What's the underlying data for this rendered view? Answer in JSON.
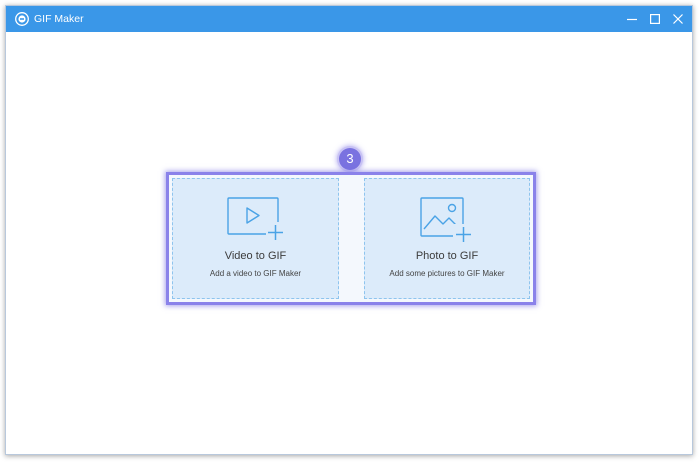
{
  "window": {
    "title": "GIF Maker",
    "app_icon": "gif-maker-logo-icon",
    "controls": {
      "minimize_icon": "minimize-icon",
      "maximize_icon": "maximize-icon",
      "close_icon": "close-icon"
    }
  },
  "step": {
    "number": "3",
    "color": "#7a72e0"
  },
  "options": [
    {
      "title": "Video to GIF",
      "subtitle": "Add a video to GIF Maker",
      "icon": "video-add-icon"
    },
    {
      "title": "Photo to GIF",
      "subtitle": "Add some pictures to GIF Maker",
      "icon": "photo-add-icon"
    }
  ],
  "colors": {
    "titlebar": "#3a97e8",
    "card_background": "#dcebfa",
    "icon_stroke": "#4aa3e6",
    "highlight": "#8a82ea"
  }
}
